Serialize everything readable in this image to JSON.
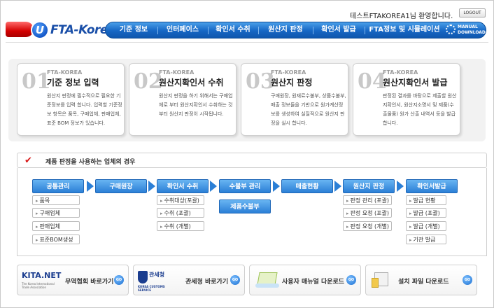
{
  "header": {
    "logo_text": "FTA-Korea",
    "logo_letter": "U",
    "welcome": "테스트FTAKOREA1님 환영합니다.",
    "logout": "LOGOUT",
    "nav": [
      "기준 정보",
      "인터페이스",
      "확인서 수취",
      "원산지 판정",
      "확인서 발급",
      "FTA정보 및 시뮬레이션"
    ],
    "manual_line1": "MANUAL",
    "manual_line2": "DOWNLOAD"
  },
  "steps": [
    {
      "num": "01",
      "sub": "FTA-KOREA",
      "title": "기준 정보 입력",
      "desc": "원산지 판정에 필수적으로 필요한 기준정보를 입력 합니다. 입력할 기준정보 항목은 품목, 구매업체, 판매업체, 표준 BOM 정보가 있습니다."
    },
    {
      "num": "02",
      "sub": "FTA-KOREA",
      "title": "원산지확인서 수취",
      "desc": "원산지 판정을 하기 위해서는 구매업체로 부터 원산지확인서 수취하는 것 부터 원산지 판정이 시작됩니다."
    },
    {
      "num": "03",
      "sub": "FTA-KOREA",
      "title": "원산지 판정",
      "desc": "구매원장, 원재료수불부, 상품수불부, 매출 정보들을 기반으로 원가계산정보를 생성하여 실질적으로 원산지 판정을 실시 합니다."
    },
    {
      "num": "04",
      "sub": "FTA-KOREA",
      "title": "원산지확인서 발급",
      "desc": "판정된 결과를 바탕으로 제출할 원산지확인서, 원산지소명서 및 제품(수출물품) 원가 산출 내역서 등을 발급합니다."
    }
  ],
  "flow": {
    "title": "제품 판정을 사용하는 업체의 경우",
    "columns": [
      {
        "label": "공통관리",
        "items": [
          "품목",
          "구매업체",
          "판매업체",
          "표준BOM생성"
        ]
      },
      {
        "label": "구매원장",
        "items": []
      },
      {
        "label": "확인서 수취",
        "items": [
          "수취대상(포괄)",
          "수취 (포괄)",
          "수취 (개별)"
        ]
      },
      {
        "label": "수불부 관리",
        "items": [],
        "extra": "제품수불부"
      },
      {
        "label": "매출현황",
        "items": []
      },
      {
        "label": "원산지 판정",
        "items": [
          "판정 관리 (포괄)",
          "판정 요청 (포괄)",
          "판정 요청 (개별)"
        ]
      },
      {
        "label": "확인서발급",
        "items": [
          "발급 현황",
          "발급 (포괄)",
          "발급 (개별)",
          "기관 발급"
        ]
      }
    ]
  },
  "banners": [
    {
      "logo": "KITA.NET",
      "logo_sub": "The Korea International Trade Association",
      "label": "무역협회 바로가기",
      "go": "GO"
    },
    {
      "logo": "관세청",
      "logo_sub": "KOREA CUSTOMS SERVICE",
      "label": "관세청 바로가기",
      "go": "GO"
    },
    {
      "logo": "",
      "logo_sub": "",
      "label": "사용자 매뉴얼 다운로드",
      "go": "GO"
    },
    {
      "logo": "",
      "logo_sub": "",
      "label": "설치 파일 다운로드",
      "go": "GO"
    }
  ],
  "colors": {
    "nav_blue": "#1666c4",
    "accent_red": "#d40000",
    "step_button": "#2b7fd6"
  }
}
